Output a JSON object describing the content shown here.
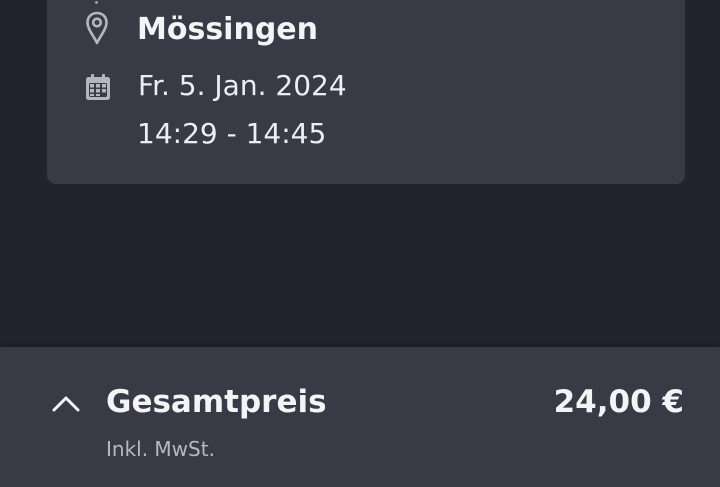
{
  "trip": {
    "stop_name": "Mössingen",
    "date": "Fr. 5. Jan. 2024",
    "time": "14:29 - 14:45",
    "icons": {
      "location": "map-pin-icon",
      "date": "calendar-icon"
    }
  },
  "price": {
    "label": "Gesamtpreis",
    "value": "24,00 €",
    "vat_note": "Inkl. MwSt.",
    "expand_icon": "chevron-up-icon"
  },
  "colors": {
    "background": "#21232e",
    "card": "#383a46",
    "text_primary": "#f4f4f6",
    "text_secondary": "#b7b9c1",
    "icon": "#b5b7c0"
  }
}
